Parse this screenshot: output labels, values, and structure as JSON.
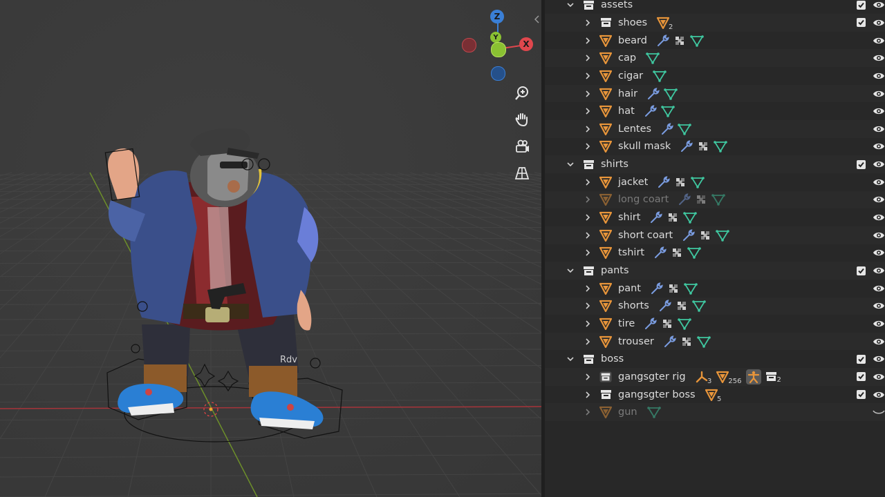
{
  "viewport": {
    "gizmo": {
      "z": "Z",
      "y": "Y",
      "x": "X"
    },
    "nav_buttons": [
      "zoom-icon",
      "hand-pan-icon",
      "camera-icon",
      "grid-ortho-icon"
    ],
    "character_text": "Rdv"
  },
  "colors": {
    "accent_orange": "#e8953a",
    "wrench_blue": "#7a9ce0",
    "mesh_green": "#3fc7a0",
    "axis_x": "#e0474d",
    "axis_y": "#8ac132",
    "axis_z": "#3a7fd6"
  },
  "outliner": {
    "rows": [
      {
        "level": 0,
        "type": "collection",
        "label": "assets",
        "open": true,
        "extras": [],
        "check": true,
        "eye": true
      },
      {
        "level": 1,
        "type": "collection",
        "label": "shoes",
        "open": false,
        "extras": [
          {
            "icon": "mesh-object-icon",
            "count": "2"
          }
        ],
        "check": true,
        "eye": true
      },
      {
        "level": 1,
        "type": "object",
        "label": "beard",
        "extras": [
          {
            "icon": "wrench-icon"
          },
          {
            "icon": "material-icon"
          },
          {
            "icon": "mesh-data-icon"
          }
        ],
        "eye": true
      },
      {
        "level": 1,
        "type": "object",
        "label": "cap",
        "extras": [
          {
            "icon": "mesh-data-icon"
          }
        ],
        "eye": true
      },
      {
        "level": 1,
        "type": "object",
        "label": "cigar",
        "extras": [
          {
            "icon": "mesh-data-icon"
          }
        ],
        "eye": true
      },
      {
        "level": 1,
        "type": "object",
        "label": "hair",
        "extras": [
          {
            "icon": "wrench-icon"
          },
          {
            "icon": "mesh-data-icon"
          }
        ],
        "eye": true
      },
      {
        "level": 1,
        "type": "object",
        "label": "hat",
        "extras": [
          {
            "icon": "wrench-icon"
          },
          {
            "icon": "mesh-data-icon"
          }
        ],
        "eye": true
      },
      {
        "level": 1,
        "type": "object",
        "label": "Lentes",
        "extras": [
          {
            "icon": "wrench-icon"
          },
          {
            "icon": "mesh-data-icon"
          }
        ],
        "eye": true
      },
      {
        "level": 1,
        "type": "object",
        "label": "skull mask",
        "extras": [
          {
            "icon": "wrench-icon"
          },
          {
            "icon": "material-icon"
          },
          {
            "icon": "mesh-data-icon"
          }
        ],
        "eye": true
      },
      {
        "level": 0,
        "type": "collection",
        "label": "shirts",
        "open": true,
        "extras": [],
        "check": true,
        "eye": true
      },
      {
        "level": 1,
        "type": "object",
        "label": "jacket",
        "extras": [
          {
            "icon": "wrench-icon"
          },
          {
            "icon": "material-icon"
          },
          {
            "icon": "mesh-data-icon"
          }
        ],
        "eye": true
      },
      {
        "level": 1,
        "type": "object",
        "label": "long coart",
        "dim": true,
        "extras": [
          {
            "icon": "wrench-icon"
          },
          {
            "icon": "material-icon"
          },
          {
            "icon": "mesh-data-icon"
          }
        ],
        "eye": true
      },
      {
        "level": 1,
        "type": "object",
        "label": "shirt",
        "extras": [
          {
            "icon": "wrench-icon"
          },
          {
            "icon": "material-icon"
          },
          {
            "icon": "mesh-data-icon"
          }
        ],
        "eye": true
      },
      {
        "level": 1,
        "type": "object",
        "label": "short coart",
        "extras": [
          {
            "icon": "wrench-icon"
          },
          {
            "icon": "material-icon"
          },
          {
            "icon": "mesh-data-icon"
          }
        ],
        "eye": true
      },
      {
        "level": 1,
        "type": "object",
        "label": "tshirt",
        "extras": [
          {
            "icon": "wrench-icon"
          },
          {
            "icon": "material-icon"
          },
          {
            "icon": "mesh-data-icon"
          }
        ],
        "eye": true
      },
      {
        "level": 0,
        "type": "collection",
        "label": "pants",
        "open": true,
        "extras": [],
        "check": true,
        "eye": true
      },
      {
        "level": 1,
        "type": "object",
        "label": "pant",
        "extras": [
          {
            "icon": "wrench-icon"
          },
          {
            "icon": "material-icon"
          },
          {
            "icon": "mesh-data-icon"
          }
        ],
        "eye": true
      },
      {
        "level": 1,
        "type": "object",
        "label": "shorts",
        "extras": [
          {
            "icon": "wrench-icon"
          },
          {
            "icon": "material-icon"
          },
          {
            "icon": "mesh-data-icon"
          }
        ],
        "eye": true
      },
      {
        "level": 1,
        "type": "object",
        "label": "tire",
        "extras": [
          {
            "icon": "wrench-icon"
          },
          {
            "icon": "material-icon"
          },
          {
            "icon": "mesh-data-icon"
          }
        ],
        "eye": true
      },
      {
        "level": 1,
        "type": "object",
        "label": "trouser",
        "extras": [
          {
            "icon": "wrench-icon"
          },
          {
            "icon": "material-icon"
          },
          {
            "icon": "mesh-data-icon"
          }
        ],
        "eye": true
      },
      {
        "level": 0,
        "type": "collection",
        "label": "boss",
        "open": true,
        "extras": [],
        "check": true,
        "eye": true
      },
      {
        "level": 1,
        "type": "collection-instance",
        "label": "gangsgter rig",
        "extras": [
          {
            "icon": "armature-icon",
            "count": "3"
          },
          {
            "icon": "mesh-object-icon",
            "count": "256"
          },
          {
            "icon": "pose-icon",
            "highlight": true
          },
          {
            "icon": "collection-icon",
            "count": "2"
          }
        ],
        "check": true,
        "eye": true
      },
      {
        "level": 1,
        "type": "collection",
        "label": "gangsgter boss",
        "extras": [
          {
            "icon": "mesh-object-icon",
            "count": "5"
          }
        ],
        "check": true,
        "eye": true
      },
      {
        "level": 1,
        "type": "object",
        "label": "gun",
        "dim": true,
        "extras": [
          {
            "icon": "mesh-data-icon"
          }
        ],
        "eye": false
      }
    ]
  }
}
